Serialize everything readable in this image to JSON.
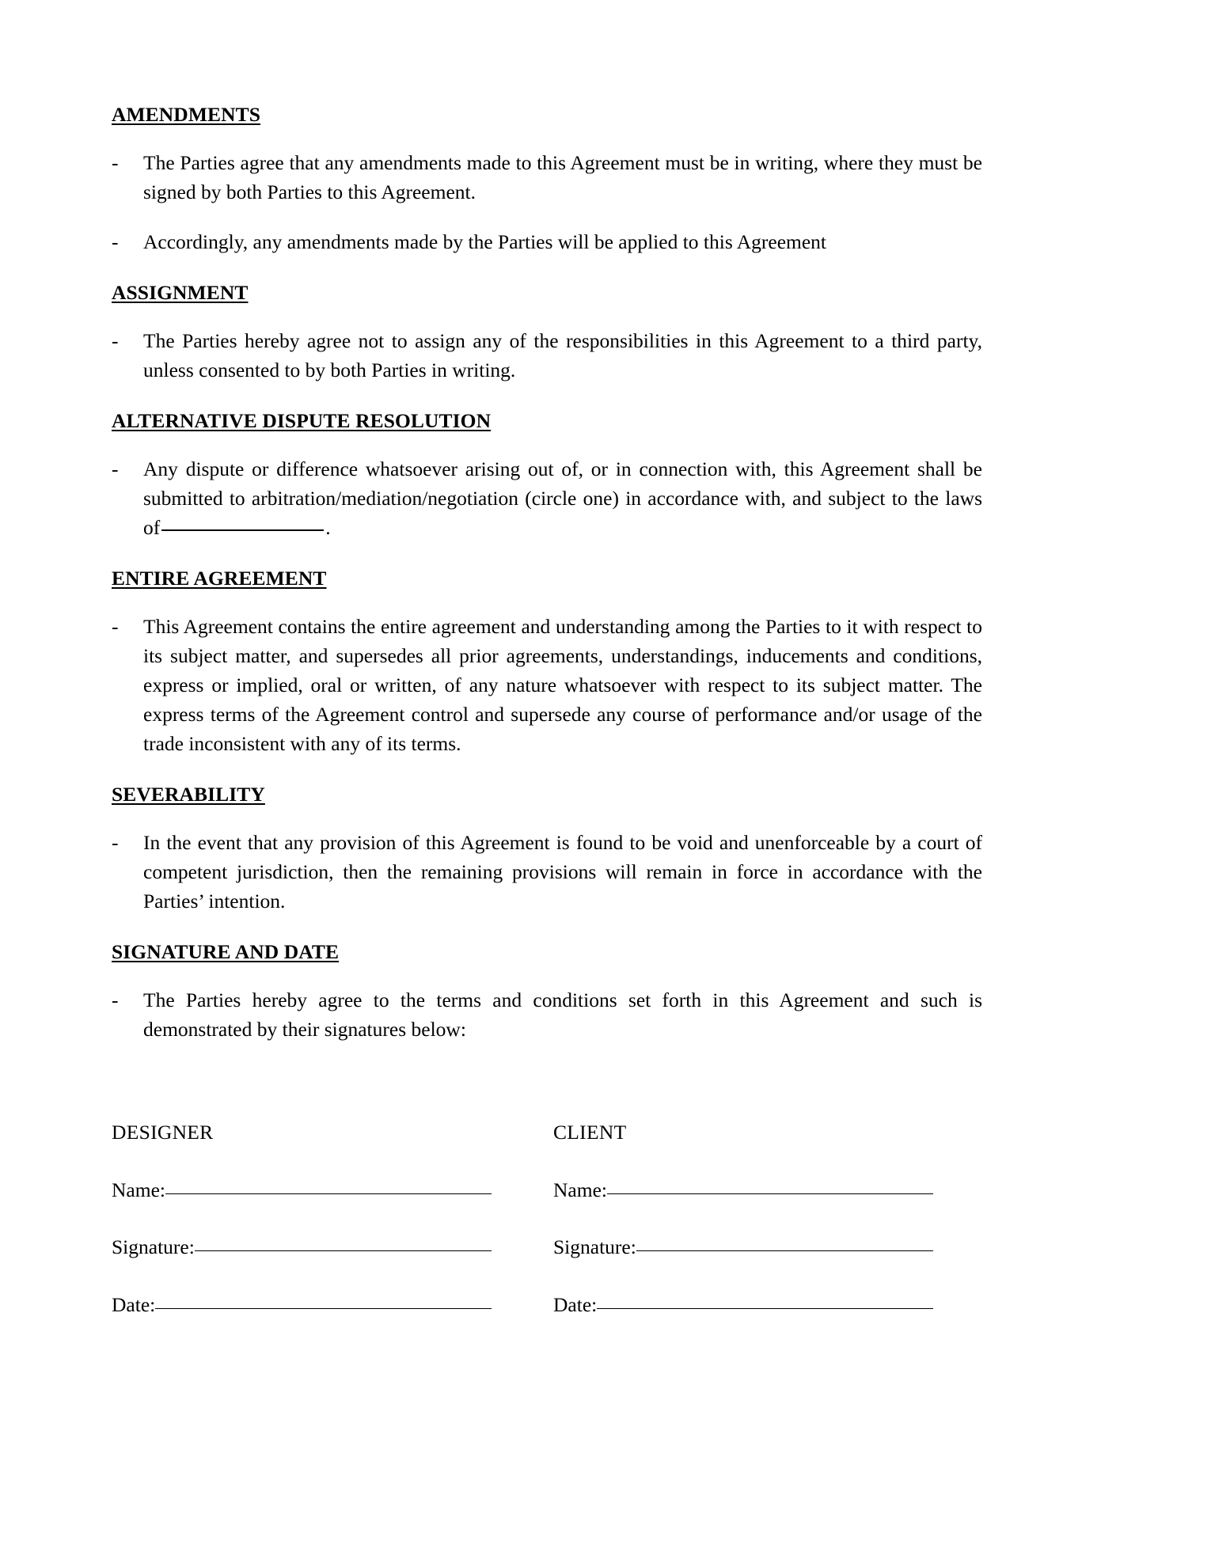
{
  "document": {
    "type": "legal-agreement-page",
    "sections": [
      {
        "heading": "AMENDMENTS",
        "items": [
          "The Parties agree that any amendments made to this Agreement must be in writing, where they must be signed by both Parties to this Agreement.",
          "Accordingly, any amendments made by the Parties will be applied to this Agreement"
        ]
      },
      {
        "heading": "ASSIGNMENT",
        "items": [
          "The Parties hereby agree not to assign any of the responsibilities in this Agreement to a third party, unless consented to by both Parties in writing."
        ]
      },
      {
        "heading": "ALTERNATIVE DISPUTE RESOLUTION",
        "items": [
          "Any dispute or difference whatsoever arising out of, or in connection with, this Agreement shall be submitted to arbitration/mediation/negotiation (circle one) in accordance with, and subject to the laws of"
        ],
        "item_suffix": "."
      },
      {
        "heading": "ENTIRE AGREEMENT",
        "items": [
          "This Agreement contains the entire agreement and understanding among the Parties to it with respect to its subject matter, and supersedes all prior agreements, understandings, inducements and conditions, express or implied, oral or written, of any nature whatsoever with respect to its subject matter. The express terms of the Agreement control and supersede any course of performance and/or usage of the trade inconsistent with any of its terms."
        ]
      },
      {
        "heading": "SEVERABILITY",
        "items": [
          "In the event that any provision of this Agreement is found to be void and unenforceable by a court of competent jurisdiction, then the remaining provisions will remain in force in accordance with the Parties’ intention."
        ]
      },
      {
        "heading": "SIGNATURE AND DATE",
        "items": [
          "The Parties hereby agree to the terms and conditions set forth in this Agreement and such is demonstrated by their signatures below:"
        ]
      }
    ],
    "bullet_marker": "-",
    "signature_block": {
      "columns": [
        {
          "party": "DESIGNER",
          "fields": [
            {
              "label": "Name:",
              "value": ""
            },
            {
              "label": "Signature:",
              "value": ""
            },
            {
              "label": "Date:",
              "value": ""
            }
          ]
        },
        {
          "party": "CLIENT",
          "fields": [
            {
              "label": "Name:",
              "value": ""
            },
            {
              "label": "Signature:",
              "value": ""
            },
            {
              "label": "Date:",
              "value": ""
            }
          ]
        }
      ]
    }
  },
  "colors": {
    "page_background": "#ffffff",
    "text": "#000000",
    "rule": "#000000"
  }
}
